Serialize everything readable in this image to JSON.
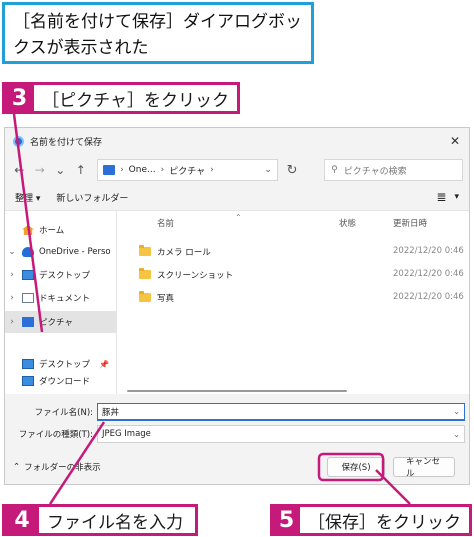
{
  "callouts": {
    "top": "［名前を付けて保存］ダイアログボックスが表示された",
    "step3": {
      "num": "3",
      "text": "［ピクチャ］をクリック"
    },
    "step4": {
      "num": "4",
      "text": "ファイル名を入力"
    },
    "step5": {
      "num": "5",
      "text": "［保存］をクリック"
    },
    "accent": "#c51a79",
    "top_border": "#1fa0d6"
  },
  "dialog": {
    "title": "名前を付けて保存",
    "nav": {
      "back": "←",
      "forward": "→",
      "recent": "⌄",
      "up": "↑",
      "address": [
        "One...",
        "ピクチャ"
      ],
      "search_placeholder": "ピクチャの検索"
    },
    "cmdbar": {
      "organize": "整理 ▾",
      "new_folder": "新しいフォルダー"
    },
    "sidebar": [
      {
        "label": "ホーム",
        "icon": "home-icon"
      },
      {
        "label": "OneDrive - Perso",
        "icon": "cloud-icon"
      },
      {
        "label": "デスクトップ",
        "icon": "desktop-icon"
      },
      {
        "label": "ドキュメント",
        "icon": "document-icon"
      },
      {
        "label": "ピクチャ",
        "icon": "picture-icon"
      },
      {
        "label": "デスクトップ",
        "icon": "desktop-icon"
      },
      {
        "label": "ダウンロード",
        "icon": "download-icon"
      }
    ],
    "columns": {
      "name": "名前",
      "status": "状態",
      "date": "更新日時"
    },
    "files": [
      {
        "name": "カメラ ロール",
        "date": "2022/12/20 0:46"
      },
      {
        "name": "スクリーンショット",
        "date": "2022/12/20 0:46"
      },
      {
        "name": "写真",
        "date": "2022/12/20 0:46"
      }
    ],
    "form": {
      "filename_label": "ファイル名(N):",
      "filename_value": "豚丼",
      "filetype_label": "ファイルの種類(T):",
      "filetype_value": "JPEG Image"
    },
    "bottom": {
      "hide_folders": "フォルダーの非表示",
      "save": "保存(S)",
      "cancel": "キャンセル"
    }
  }
}
